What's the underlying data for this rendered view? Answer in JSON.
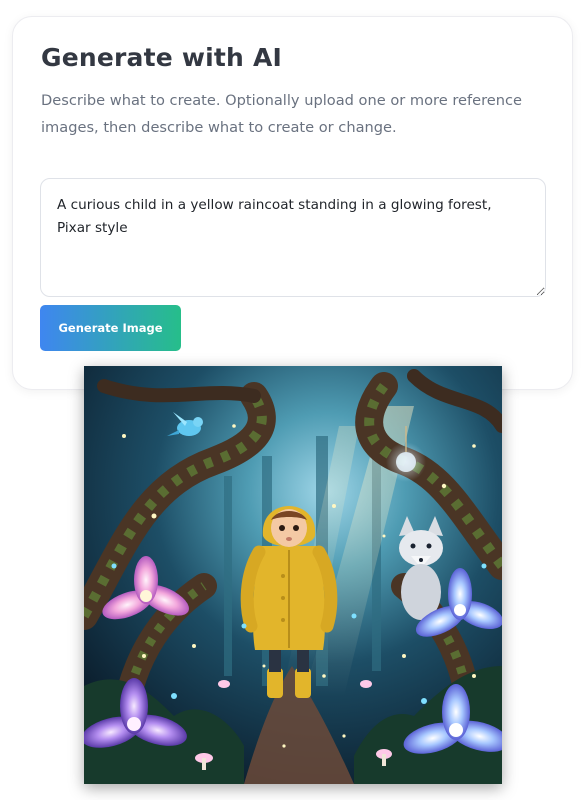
{
  "generator": {
    "title": "Generate with AI",
    "description": "Describe what to create. Optionally upload one or more reference images, then describe what to create or change.",
    "prompt_value": "A curious child in a yellow raincoat standing in a glowing forest, Pixar style",
    "generate_label": "Generate Image"
  },
  "colors": {
    "button_gradient_start": "#3f86f0",
    "button_gradient_end": "#26be8a",
    "raincoat": "#e2b52b"
  }
}
